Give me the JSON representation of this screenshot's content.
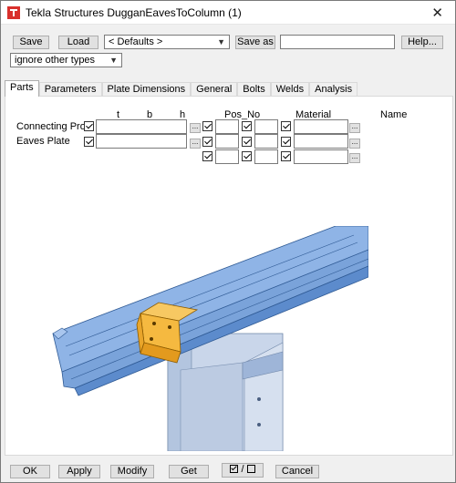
{
  "window": {
    "title": "Tekla Structures  DugganEavesToColumn (1)"
  },
  "toolbar": {
    "save_label": "Save",
    "load_label": "Load",
    "defaults_value": "< Defaults >",
    "save_as_label": "Save as",
    "save_as_value": "",
    "help_label": "Help...",
    "filter_value": "ignore other types"
  },
  "tabs": [
    "Parts",
    "Parameters",
    "Plate Dimensions",
    "General",
    "Bolts",
    "Welds",
    "Analysis"
  ],
  "parts": {
    "headers": {
      "t": "t",
      "b": "b",
      "h": "h",
      "pos_no": "Pos_No",
      "material": "Material",
      "name": "Name"
    },
    "rows": [
      {
        "label": "Connecting Profil"
      },
      {
        "label": "Eaves Plate"
      }
    ]
  },
  "footer": {
    "ok_label": "OK",
    "apply_label": "Apply",
    "modify_label": "Modify",
    "get_label": "Get",
    "toggle_label": "/",
    "cancel_label": "Cancel"
  },
  "colors": {
    "beam": "#8fb4e6",
    "plate": "#f5b940",
    "column": "#c9d6ea",
    "accent": "#3d6fb6"
  }
}
